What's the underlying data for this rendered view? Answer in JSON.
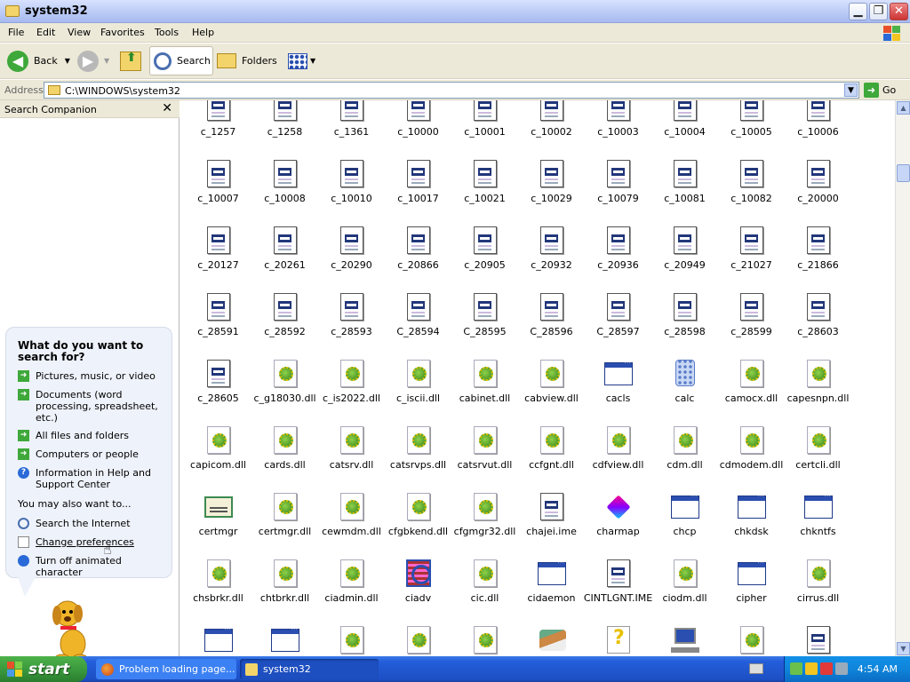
{
  "window": {
    "title": "system32"
  },
  "menu": [
    "File",
    "Edit",
    "View",
    "Favorites",
    "Tools",
    "Help"
  ],
  "toolbar": {
    "back": "Back",
    "search": "Search",
    "folders": "Folders"
  },
  "address": {
    "label": "Address",
    "path": "C:\\WINDOWS\\system32",
    "go": "Go"
  },
  "side": {
    "title": "Search Companion",
    "question": "What do you want to search for?",
    "options": [
      "Pictures, music, or video",
      "Documents (word processing, spreadsheet, etc.)",
      "All files and folders",
      "Computers or people",
      "Information in Help and Support Center"
    ],
    "also_label": "You may also want to...",
    "links": [
      "Search the Internet",
      "Change preferences",
      "Turn off animated character"
    ]
  },
  "files": [
    {
      "name": "c_1257",
      "icon": "doc"
    },
    {
      "name": "c_1258",
      "icon": "doc"
    },
    {
      "name": "c_1361",
      "icon": "doc"
    },
    {
      "name": "c_10000",
      "icon": "doc"
    },
    {
      "name": "c_10001",
      "icon": "doc"
    },
    {
      "name": "c_10002",
      "icon": "doc"
    },
    {
      "name": "c_10003",
      "icon": "doc"
    },
    {
      "name": "c_10004",
      "icon": "doc"
    },
    {
      "name": "c_10005",
      "icon": "doc"
    },
    {
      "name": "c_10006",
      "icon": "doc"
    },
    {
      "name": "c_10007",
      "icon": "doc"
    },
    {
      "name": "c_10008",
      "icon": "doc"
    },
    {
      "name": "c_10010",
      "icon": "doc"
    },
    {
      "name": "c_10017",
      "icon": "doc"
    },
    {
      "name": "c_10021",
      "icon": "doc"
    },
    {
      "name": "c_10029",
      "icon": "doc"
    },
    {
      "name": "c_10079",
      "icon": "doc"
    },
    {
      "name": "c_10081",
      "icon": "doc"
    },
    {
      "name": "c_10082",
      "icon": "doc"
    },
    {
      "name": "c_20000",
      "icon": "doc"
    },
    {
      "name": "c_20127",
      "icon": "doc"
    },
    {
      "name": "c_20261",
      "icon": "doc"
    },
    {
      "name": "c_20290",
      "icon": "doc"
    },
    {
      "name": "c_20866",
      "icon": "doc"
    },
    {
      "name": "c_20905",
      "icon": "doc"
    },
    {
      "name": "c_20932",
      "icon": "doc"
    },
    {
      "name": "c_20936",
      "icon": "doc"
    },
    {
      "name": "c_20949",
      "icon": "doc"
    },
    {
      "name": "c_21027",
      "icon": "doc"
    },
    {
      "name": "c_21866",
      "icon": "doc"
    },
    {
      "name": "c_28591",
      "icon": "doc"
    },
    {
      "name": "c_28592",
      "icon": "doc"
    },
    {
      "name": "c_28593",
      "icon": "doc"
    },
    {
      "name": "C_28594",
      "icon": "doc"
    },
    {
      "name": "C_28595",
      "icon": "doc"
    },
    {
      "name": "C_28596",
      "icon": "doc"
    },
    {
      "name": "C_28597",
      "icon": "doc"
    },
    {
      "name": "c_28598",
      "icon": "doc"
    },
    {
      "name": "c_28599",
      "icon": "doc"
    },
    {
      "name": "c_28603",
      "icon": "doc"
    },
    {
      "name": "c_28605",
      "icon": "doc"
    },
    {
      "name": "c_g18030.dll",
      "icon": "dll"
    },
    {
      "name": "c_is2022.dll",
      "icon": "dll"
    },
    {
      "name": "c_iscii.dll",
      "icon": "dll"
    },
    {
      "name": "cabinet.dll",
      "icon": "dll"
    },
    {
      "name": "cabview.dll",
      "icon": "dll"
    },
    {
      "name": "cacls",
      "icon": "win"
    },
    {
      "name": "calc",
      "icon": "calc"
    },
    {
      "name": "camocx.dll",
      "icon": "dll"
    },
    {
      "name": "capesnpn.dll",
      "icon": "dll"
    },
    {
      "name": "capicom.dll",
      "icon": "dll"
    },
    {
      "name": "cards.dll",
      "icon": "dll"
    },
    {
      "name": "catsrv.dll",
      "icon": "dll"
    },
    {
      "name": "catsrvps.dll",
      "icon": "dll"
    },
    {
      "name": "catsrvut.dll",
      "icon": "dll"
    },
    {
      "name": "ccfgnt.dll",
      "icon": "dll"
    },
    {
      "name": "cdfview.dll",
      "icon": "dll"
    },
    {
      "name": "cdm.dll",
      "icon": "dll"
    },
    {
      "name": "cdmodem.dll",
      "icon": "dll"
    },
    {
      "name": "certcli.dll",
      "icon": "dll"
    },
    {
      "name": "certmgr",
      "icon": "cert"
    },
    {
      "name": "certmgr.dll",
      "icon": "dll"
    },
    {
      "name": "cewmdm.dll",
      "icon": "dll"
    },
    {
      "name": "cfgbkend.dll",
      "icon": "dll"
    },
    {
      "name": "cfgmgr32.dll",
      "icon": "dll"
    },
    {
      "name": "chajei.ime",
      "icon": "doc"
    },
    {
      "name": "charmap",
      "icon": "cube"
    },
    {
      "name": "chcp",
      "icon": "win"
    },
    {
      "name": "chkdsk",
      "icon": "win"
    },
    {
      "name": "chkntfs",
      "icon": "win"
    },
    {
      "name": "chsbrkr.dll",
      "icon": "dll"
    },
    {
      "name": "chtbrkr.dll",
      "icon": "dll"
    },
    {
      "name": "ciadmin.dll",
      "icon": "dll"
    },
    {
      "name": "ciadv",
      "icon": "grid"
    },
    {
      "name": "cic.dll",
      "icon": "dll"
    },
    {
      "name": "cidaemon",
      "icon": "win"
    },
    {
      "name": "CINTLGNT.IME",
      "icon": "doc"
    },
    {
      "name": "ciodm.dll",
      "icon": "dll"
    },
    {
      "name": "cipher",
      "icon": "win"
    },
    {
      "name": "cirrus.dll",
      "icon": "dll"
    },
    {
      "name": "",
      "icon": "win"
    },
    {
      "name": "",
      "icon": "win"
    },
    {
      "name": "",
      "icon": "dll"
    },
    {
      "name": "",
      "icon": "dll"
    },
    {
      "name": "",
      "icon": "dll"
    },
    {
      "name": "",
      "icon": "brush"
    },
    {
      "name": "",
      "icon": "help"
    },
    {
      "name": "",
      "icon": "net"
    },
    {
      "name": "",
      "icon": "dll"
    },
    {
      "name": "",
      "icon": "doc"
    }
  ],
  "taskbar": {
    "start": "start",
    "tasks": [
      "Problem loading page...",
      "system32"
    ],
    "clock": "4:54 AM"
  },
  "colors": {
    "accent": "#245edb",
    "start_green": "#37953b",
    "title_gradient": "#b9c9f5"
  }
}
